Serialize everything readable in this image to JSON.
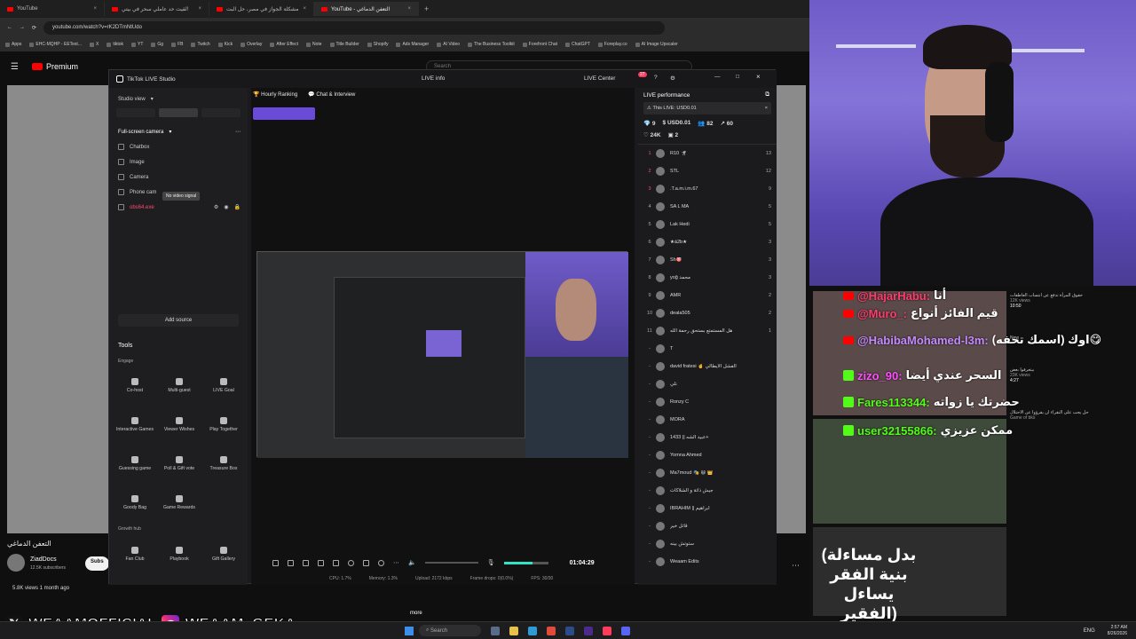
{
  "browser": {
    "tabs": [
      {
        "label": "YouTube"
      },
      {
        "label": "لقيت حد عاملي سحر في بيتي!"
      },
      {
        "label": "مشكلة الجواز في مصر، حل البت"
      },
      {
        "label": "YouTube - التعفن الدماغي",
        "active": true
      }
    ],
    "new_tab": "+",
    "url": "youtube.com/watch?v=rK2DTmNtUdo",
    "bookmarks": [
      "Apps",
      "EHC-MQHP - EETest...",
      "X",
      "tiktok",
      "YT",
      "Gg",
      "FB",
      "Twitch",
      "Kick",
      "Overlay",
      "After Effect",
      "Note",
      "Title Builder",
      "Shopify",
      "Ads Manager",
      "AI Video",
      "The Business Toolkit",
      "Forefront Chat",
      "ChatGPT",
      "Foreplay.co",
      "AI Image Upscaler"
    ]
  },
  "youtube": {
    "logo": "Premium",
    "search_placeholder": "Search",
    "video_title": "التعفن الدماغي",
    "channel": "ZiadDocs",
    "subscribers": "12.5K subscribers",
    "subscribe": "Subs",
    "views": "5.8K views  1 month ago",
    "more": "more"
  },
  "studio": {
    "title": "TikTok LIVE Studio",
    "live_info": "LIVE info",
    "live_center": "LIVE Center",
    "notif_count": "27",
    "studio_view": "Studio view",
    "hourly_ranking": "Hourly Ranking",
    "chat_interview": "Chat & Interview",
    "scene": "Full-screen camera",
    "sources": [
      {
        "label": "Chatbox",
        "icon": "chatbox-icon"
      },
      {
        "label": "Image",
        "icon": "image-icon"
      },
      {
        "label": "Camera",
        "icon": "camera-icon"
      },
      {
        "label": "Phone cam",
        "icon": "phone-icon"
      },
      {
        "label": "obs64.exe",
        "icon": "app-icon",
        "error": true
      }
    ],
    "no_video_tooltip": "No video signal",
    "add_source": "Add source",
    "tools_title": "Tools",
    "engage_title": "Engage",
    "engage_tools": [
      "Co-host",
      "Multi-guest",
      "LIVE Goal",
      "Interactive Games",
      "Viewer Wishes",
      "Play Together",
      "Guessing game",
      "Poll & Gift vote",
      "Treasure Box",
      "Goody Bag",
      "Game Rewards"
    ],
    "growth_title": "Growth hub",
    "growth_tools": [
      "Fan Club",
      "Playbook",
      "Gift Gallery"
    ],
    "timer": "01:04:29",
    "status": {
      "cpu": "CPU: 1.7%",
      "memory": "Memory: 1.3%",
      "upload": "Upload: 2172 kbps",
      "frame_drops": "Frame drops: 0(0.0%)",
      "fps": "FPS: 30/30"
    }
  },
  "performance": {
    "title": "LIVE performance",
    "this_live": "This LIVE: USD0.01",
    "stats": {
      "gifts": "9",
      "usd": "USD0.01",
      "viewers": "82",
      "shares": "60",
      "likes": "24K",
      "comments": "2"
    },
    "leaderboard": [
      {
        "rank": "1",
        "name": "R10 🤺",
        "score": "13"
      },
      {
        "rank": "2",
        "name": "STL",
        "score": "12"
      },
      {
        "rank": "3",
        "name": ".T.a.m.i.m.67",
        "score": "9"
      },
      {
        "rank": "4",
        "name": "SA L MA",
        "score": "5"
      },
      {
        "rank": "5",
        "name": "Lak Hedi",
        "score": "5"
      },
      {
        "rank": "6",
        "name": "★á2b★",
        "score": "3"
      },
      {
        "rank": "7",
        "name": "Sh🎯",
        "score": "3"
      },
      {
        "rank": "8",
        "name": "yoğ محمد",
        "score": "3"
      },
      {
        "rank": "9",
        "name": "AMR",
        "score": "2"
      },
      {
        "rank": "10",
        "name": "deala505",
        "score": "2"
      },
      {
        "rank": "11",
        "name": "هل المستمتع بستحق رحمة الله",
        "score": "1"
      },
      {
        "rank": "-",
        "name": "T",
        "score": ""
      },
      {
        "rank": "-",
        "name": "david fratesi 🤞 الفشل الأيطالي",
        "score": ""
      },
      {
        "rank": "-",
        "name": "نلي",
        "score": ""
      },
      {
        "rank": "-",
        "name": "Ronzy C",
        "score": ""
      },
      {
        "rank": "-",
        "name": "MORA",
        "score": ""
      },
      {
        "rank": "-",
        "name": "عبيد الشه || 1433+",
        "score": ""
      },
      {
        "rank": "-",
        "name": "Yomna Ahmed",
        "score": ""
      },
      {
        "rank": "-",
        "name": "Ma7moud 🎭 😄 👑",
        "score": ""
      },
      {
        "rank": "-",
        "name": "جيش ذاتة و الشلاكات",
        "score": ""
      },
      {
        "rank": "-",
        "name": "IBRAHIM || ابراهيم",
        "score": ""
      },
      {
        "rank": "-",
        "name": "قاتل خير",
        "score": ""
      },
      {
        "rank": "-",
        "name": "ستوتش بينه",
        "score": ""
      },
      {
        "rank": "-",
        "name": "Weaam Edits",
        "score": ""
      }
    ]
  },
  "chat_overlay": {
    "lines": [
      {
        "platform": "youtube",
        "user": "@HajarHabu:",
        "text": "أنا",
        "color": "#ff3c6e"
      },
      {
        "platform": "youtube",
        "user": "@Muro_:",
        "text": "قيم الفائز أنواع",
        "color": "#ff3c6e"
      },
      {
        "platform": "youtube",
        "user": "@HabibaMohamed-l3m:",
        "text": "اوك (اسمك تحفه)😋",
        "color": "#c38bff"
      },
      {
        "platform": "kick",
        "user": "zizo_90:",
        "text": "السحر عندي أيضا",
        "color": "#ff4dff"
      },
      {
        "platform": "kick",
        "user": "Fares113344:",
        "text": "حضرتك يا زواته",
        "color": "#53fc18"
      },
      {
        "platform": "kick",
        "user": "user32155866:",
        "text": "ممكن عزيزي",
        "color": "#53fc18"
      }
    ],
    "side_items": [
      {
        "title": "حقوق المرأة تدفع عن انتساب العاطفات",
        "meta": "12K views",
        "time": "10:50"
      },
      {
        "title": "New"
      },
      {
        "title": "بيتعرفوا بعض",
        "meta": "23K views",
        "time": "4:27"
      },
      {
        "title": "حل يجب على النقراء ان يقرؤوا عن الاحتلال",
        "meta": "Game of bks"
      }
    ]
  },
  "thumb_text": "(بدل مساءلة بنية الفقر يساءل الفقير)",
  "watermark": {
    "x": "WEAAMOFFICIAL",
    "insta": "WEAAM_GEKA"
  },
  "taskbar": {
    "search": "Search",
    "lang": "ENG",
    "time": "2:57 AM",
    "date": "8/26/2026"
  },
  "colors": {
    "accent_red": "#ff0033",
    "kick_green": "#53fc18",
    "tiktok_pink": "#ff4d6a"
  }
}
